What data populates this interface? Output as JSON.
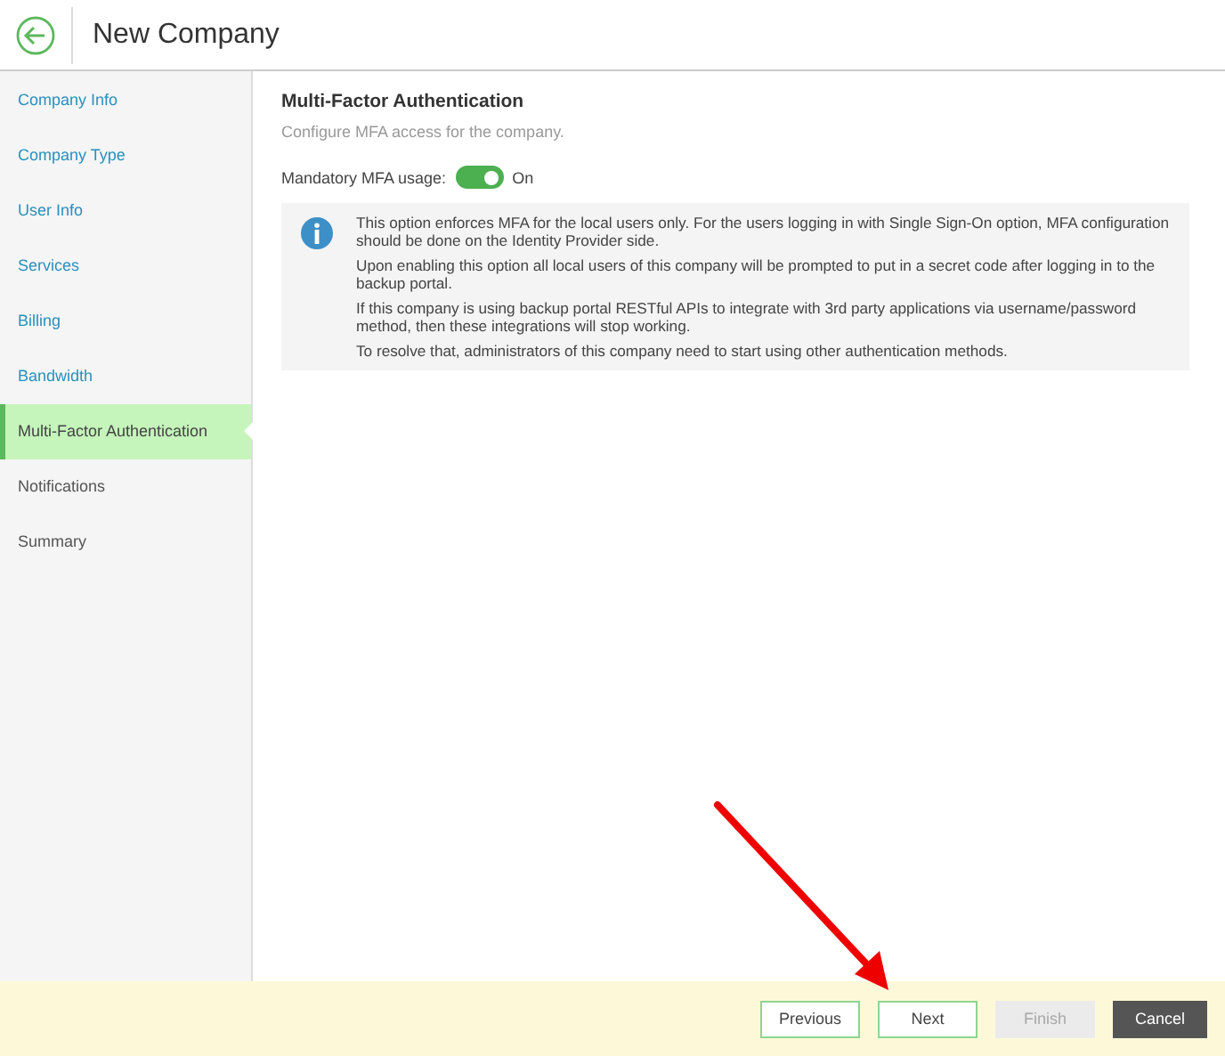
{
  "header": {
    "title": "New Company"
  },
  "sidebar": {
    "items": [
      {
        "label": "Company Info",
        "selected": false,
        "completed": true
      },
      {
        "label": "Company Type",
        "selected": false,
        "completed": true
      },
      {
        "label": "User Info",
        "selected": false,
        "completed": true
      },
      {
        "label": "Services",
        "selected": false,
        "completed": true
      },
      {
        "label": "Billing",
        "selected": false,
        "completed": true
      },
      {
        "label": "Bandwidth",
        "selected": false,
        "completed": true
      },
      {
        "label": "Multi-Factor Authentication",
        "selected": true,
        "completed": false
      },
      {
        "label": "Notifications",
        "selected": false,
        "completed": false
      },
      {
        "label": "Summary",
        "selected": false,
        "completed": false
      }
    ]
  },
  "content": {
    "heading": "Multi-Factor Authentication",
    "subtitle": "Configure MFA access for the company.",
    "mfa_toggle": {
      "label": "Mandatory MFA usage:",
      "on": true,
      "state_text": "On"
    },
    "info": {
      "paragraphs": [
        "This option enforces MFA for the local users only. For the users logging in with Single Sign-On option, MFA configuration should be done on the Identity Provider side.",
        "Upon enabling this option all local users of this company will be prompted to put in a secret code after logging in to the backup portal.",
        "If this company is using backup portal RESTful APIs to integrate with 3rd party applications via username/password method, then these integrations will stop working.",
        "To resolve that, administrators of this company need to start using other authentication methods."
      ]
    }
  },
  "footer": {
    "buttons": [
      {
        "label": "Previous",
        "kind": "secondary",
        "disabled": false
      },
      {
        "label": "Next",
        "kind": "secondary",
        "disabled": false
      },
      {
        "label": "Finish",
        "kind": "secondary",
        "disabled": true
      },
      {
        "label": "Cancel",
        "kind": "dark",
        "disabled": false
      }
    ]
  }
}
